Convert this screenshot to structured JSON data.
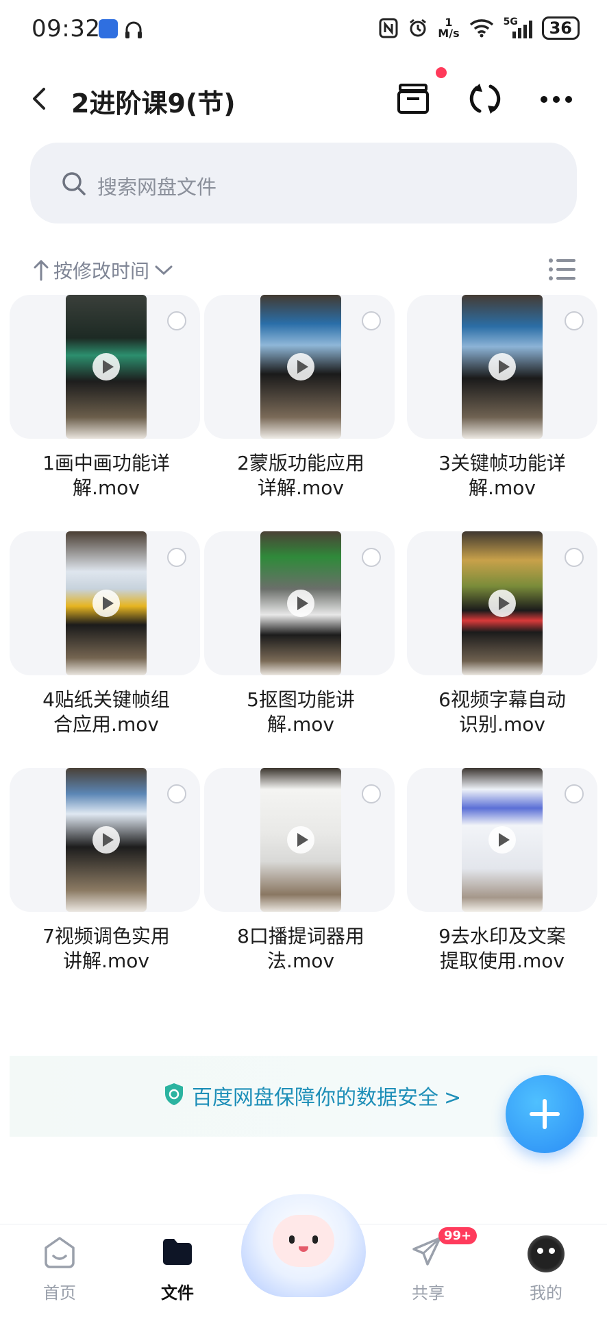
{
  "status_bar": {
    "time": "09:32",
    "speed_top": "1",
    "speed_unit": "M/s",
    "network": "5G",
    "battery": "36"
  },
  "header": {
    "title": "2进阶课9(节)"
  },
  "search": {
    "placeholder": "搜索网盘文件"
  },
  "sort": {
    "label": "按修改时间"
  },
  "files": [
    {
      "name": "1画中画功能详解.mov",
      "line1": "1画中画功能详",
      "line2": "解.mov"
    },
    {
      "name": "2蒙版功能应用详解.mov",
      "line1": "2蒙版功能应用",
      "line2": "详解.mov"
    },
    {
      "name": "3关键帧功能详解.mov",
      "line1": "3关键帧功能详",
      "line2": "解.mov"
    },
    {
      "name": "4贴纸关键帧组合应用.mov",
      "line1": "4贴纸关键帧组",
      "line2": "合应用.mov"
    },
    {
      "name": "5抠图功能讲解.mov",
      "line1": "5抠图功能讲",
      "line2": "解.mov"
    },
    {
      "name": "6视频字幕自动识别.mov",
      "line1": "6视频字幕自动",
      "line2": "识别.mov"
    },
    {
      "name": "7视频调色实用讲解.mov",
      "line1": "7视频调色实用",
      "line2": "讲解.mov"
    },
    {
      "name": "8口播提词器用法.mov",
      "line1": "8口播提词器用",
      "line2": "法.mov"
    },
    {
      "name": "9去水印及文案提取使用.mov",
      "line1": "9去水印及文案",
      "line2": "提取使用.mov"
    }
  ],
  "banner": {
    "text": "百度网盘保障你的数据安全",
    "arrow": ">"
  },
  "bottom_nav": {
    "items": [
      {
        "label": "首页"
      },
      {
        "label": "文件"
      },
      {
        "label": "共享"
      },
      {
        "label": "我的"
      }
    ],
    "share_badge": "99+"
  },
  "colors": {
    "accent": "#2a8cf5",
    "banner_text": "#1e8fb8",
    "badge": "#ff3b5c"
  }
}
